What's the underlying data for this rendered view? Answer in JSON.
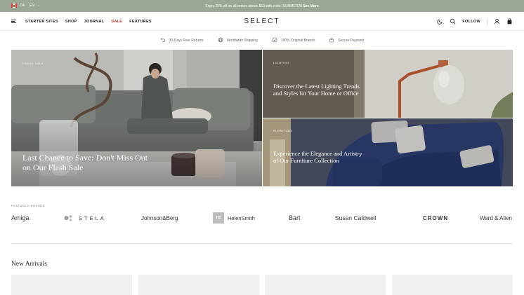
{
  "announcement": {
    "country": "CA",
    "language": "EN",
    "message": "Enjoy 20% off on all orders above $50 with code: SUMMER20",
    "link": "See More"
  },
  "header": {
    "logo": "SELECT",
    "nav": [
      "STARTER SITES",
      "SHOP",
      "JOURNAL",
      "SALE",
      "FEATURES"
    ],
    "follow": "FOLLOW"
  },
  "usps": [
    {
      "icon": "return-arrow-icon",
      "label": "30-Days Free Returns"
    },
    {
      "icon": "globe-icon",
      "label": "Worldwide Shipping"
    },
    {
      "icon": "check-badge-icon",
      "label": "100% Original Brands"
    },
    {
      "icon": "lock-icon",
      "label": "Secure Payment"
    }
  ],
  "hero": {
    "main": {
      "eyebrow": "FRESH SALE",
      "heading": "Last Chance to Save: Don't Miss Out on Our Flash Sale"
    },
    "top_right": {
      "eyebrow": "LIGHTING",
      "heading": "Discover the Latest Lighting Trends and Styles for Your Home or Office"
    },
    "bottom_right": {
      "eyebrow": "FURNITURE",
      "heading": "Experience the Elegance and Artistry of Our Furniture Collection"
    }
  },
  "brands": {
    "label": "FEATURED BRANDS",
    "items": [
      "Amiga",
      "STELA",
      "Johnson&Berg",
      "HelenSmith",
      "Bart",
      "Susan Caldwell",
      "CROWN",
      "Ward & Allen"
    ],
    "helen_badge": "HS"
  },
  "arrivals": {
    "title": "New Arrivals"
  },
  "colors": {
    "announcement_bg": "#9ca896",
    "sale": "#c23b30"
  }
}
